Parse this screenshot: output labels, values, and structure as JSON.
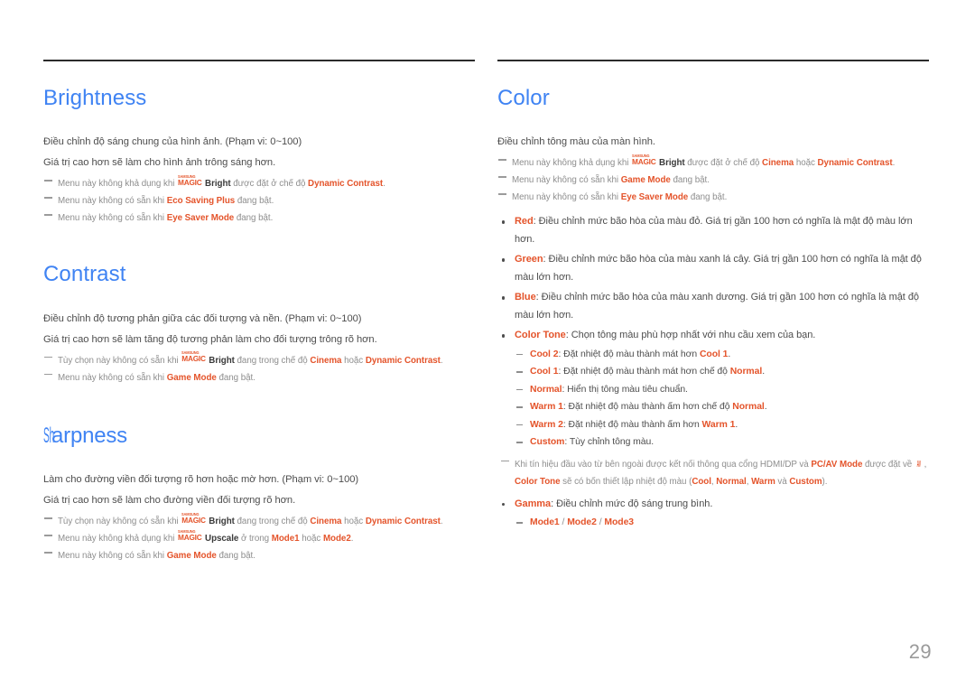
{
  "page": {
    "number": "29",
    "accent_blue": "#3f83f3",
    "accent_orange": "#e4542b",
    "body_gray": "#4d4d4d",
    "note_gray": "#8e8e8e"
  },
  "left_column": {
    "sections": [
      {
        "title": "Brightness",
        "body": [
          "Điều chỉnh độ sáng chung của hình ảnh. (Phạm vi: 0~100)",
          "Giá trị cao hơn sẽ làm cho hình ảnh trông sáng hơn."
        ],
        "notes": [
          {
            "pre": "Menu này không khả dụng khi ",
            "magic": {
              "samsung": "SAMSUNG",
              "magic": "MAGIC",
              "suffix": "Bright"
            },
            "mid": " được đặt ở chế độ ",
            "terms": [
              "Dynamic Contrast"
            ],
            "post": "."
          },
          {
            "pre": "Menu này không có sẵn khi ",
            "terms": [
              "Eco Saving Plus"
            ],
            "post": " đang bật."
          },
          {
            "pre": "Menu này không có sẵn khi ",
            "terms": [
              "Eye Saver Mode"
            ],
            "post": " đang bật."
          }
        ]
      },
      {
        "title": "Contrast",
        "body": [
          "Điều chỉnh độ tương phản giữa các đối tượng và nền. (Phạm vi: 0~100)",
          "Giá trị cao hơn sẽ làm tăng độ tương phản làm cho đối tượng trông rõ hơn."
        ],
        "notes": [
          {
            "pre": "Tùy chọn này không có sẵn khi ",
            "magic": {
              "samsung": "SAMSUNG",
              "magic": "MAGIC",
              "suffix": "Bright"
            },
            "mid": " đang trong chế độ ",
            "terms": [
              "Cinema",
              "Dynamic Contrast"
            ],
            "joiner": " hoặc ",
            "post": "."
          },
          {
            "pre": "Menu này không có sẵn khi ",
            "terms": [
              "Game Mode"
            ],
            "post": " đang bật."
          }
        ]
      },
      {
        "title": "Sharpness",
        "title_squeeze_prefix": "Sh",
        "title_squeeze_rest": "arpness",
        "body": [
          "Làm cho đường viền đối tượng rõ hơn hoặc mờ hơn. (Phạm vi: 0~100)",
          "Giá trị cao hơn sẽ làm cho đường viền đối tượng rõ hơn."
        ],
        "notes": [
          {
            "pre": "Tùy chọn này không có sẵn khi ",
            "magic": {
              "samsung": "SAMSUNG",
              "magic": "MAGIC",
              "suffix": "Bright"
            },
            "mid": " đang trong chế độ ",
            "terms": [
              "Cinema",
              "Dynamic Contrast"
            ],
            "joiner": " hoặc ",
            "post": "."
          },
          {
            "pre": "Menu này không khả dụng khi ",
            "magic": {
              "samsung": "SAMSUNG",
              "magic": "MAGIC",
              "suffix": "Upscale"
            },
            "mid": " ở trong ",
            "terms": [
              "Mode1",
              "Mode2"
            ],
            "joiner": " hoặc ",
            "post": "."
          },
          {
            "pre": "Menu này không có sẵn khi ",
            "terms": [
              "Game Mode"
            ],
            "post": " đang bật."
          }
        ]
      }
    ]
  },
  "right_column": {
    "section": {
      "title": "Color",
      "body": [
        "Điều chỉnh tông màu của màn hình."
      ],
      "notes": [
        {
          "pre": "Menu này không khả dụng khi ",
          "magic": {
            "samsung": "SAMSUNG",
            "magic": "MAGIC",
            "suffix": "Bright"
          },
          "mid": " được đặt ở chế độ ",
          "terms": [
            "Cinema",
            "Dynamic Contrast"
          ],
          "joiner": " hoặc ",
          "post": "."
        },
        {
          "pre": "Menu này không có sẵn khi ",
          "terms": [
            "Game Mode"
          ],
          "post": " đang bật."
        },
        {
          "pre": "Menu này không có sẵn khi ",
          "terms": [
            "Eye Saver Mode"
          ],
          "post": " đang bật."
        }
      ],
      "bullets": [
        {
          "term": "Red",
          "text": ": Điều chỉnh mức bão hòa của màu đỏ. Giá trị gần 100 hơn có nghĩa là mật độ màu lớn hơn."
        },
        {
          "term": "Green",
          "text": ": Điều chỉnh mức bão hòa của màu xanh lá cây. Giá trị gần 100 hơn có nghĩa là mật độ màu lớn hơn."
        },
        {
          "term": "Blue",
          "text": ": Điều chỉnh mức bão hòa của màu xanh dương. Giá trị gần 100 hơn có nghĩa là mật độ màu lớn hơn."
        },
        {
          "term": "Color Tone",
          "text": ": Chọn tông màu phù hợp nhất với nhu cầu xem của bạn."
        }
      ],
      "color_tone_options": [
        {
          "term": "Cool 2",
          "pre": ": Đặt nhiệt độ màu thành mát hơn ",
          "ref": "Cool 1",
          "post": "."
        },
        {
          "term": "Cool 1",
          "pre": ": Đặt nhiệt độ màu thành mát hơn chế độ ",
          "ref": "Normal",
          "post": "."
        },
        {
          "term": "Normal",
          "pre": ": Hiển thị tông màu tiêu chuẩn.",
          "ref": "",
          "post": ""
        },
        {
          "term": "Warm 1",
          "pre": ": Đặt nhiệt độ màu thành ấm hơn chế độ ",
          "ref": "Normal",
          "post": "."
        },
        {
          "term": "Warm 2",
          "pre": ": Đặt nhiệt độ màu thành ấm hơn ",
          "ref": "Warm 1",
          "post": "."
        },
        {
          "term": "Custom",
          "pre": ": Tùy chỉnh tông màu.",
          "ref": "",
          "post": ""
        }
      ],
      "hdmi_note": {
        "line1_pre": "Khi tín hiệu đầu vào từ bên ngoài được kết nối thông qua cổng HDMI/DP và ",
        "line1_term": "PC/AV Mode",
        "line1_mid": " được đặt về ",
        "line1_squeezed": "AV",
        "line1_post": " ,",
        "line2_term": "Color Tone",
        "line2_mid": " sẽ có bốn thiết lập nhiệt độ màu (",
        "line2_opts": [
          "Cool",
          "Normal",
          "Warm"
        ],
        "line2_joiner": " và ",
        "line2_last": "Custom",
        "line2_post": ")."
      },
      "gamma_bullet": {
        "term": "Gamma",
        "text": ": Điều chỉnh mức độ sáng trung bình."
      },
      "gamma_modes": {
        "items": [
          "Mode1",
          "Mode2",
          "Mode3"
        ],
        "separator": " / "
      }
    }
  }
}
